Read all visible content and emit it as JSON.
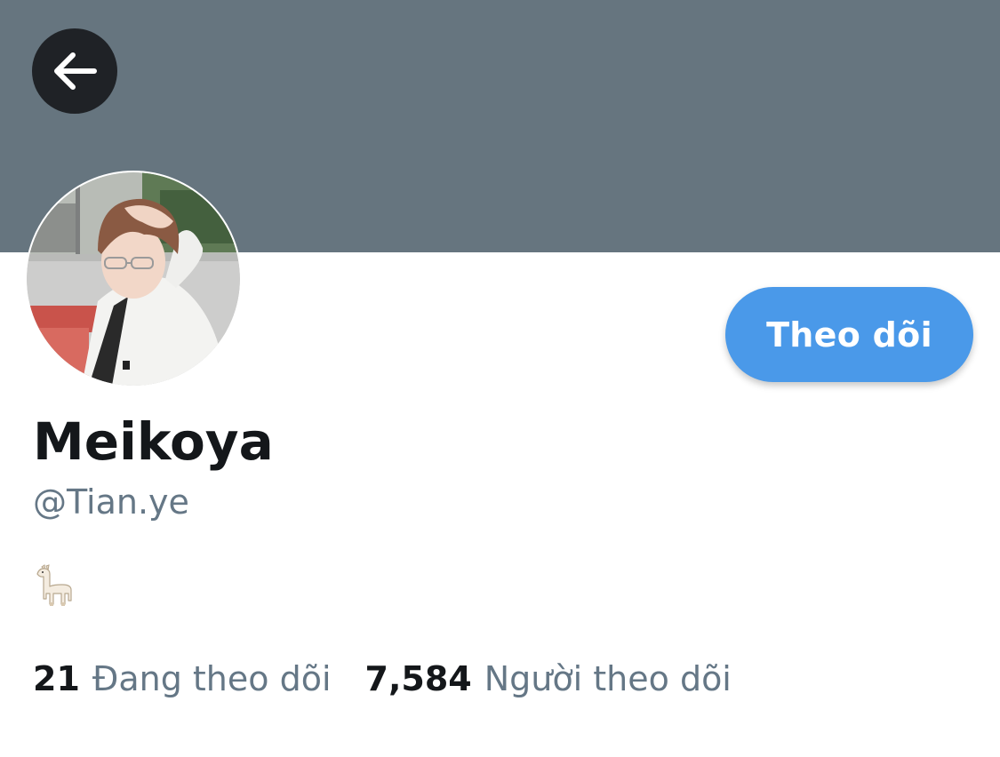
{
  "header": {
    "banner_color": "#66757f",
    "back_icon": "arrow-left-icon"
  },
  "profile": {
    "display_name": "Meikoya",
    "handle": "@Tian.ye",
    "bio_emoji": "llama",
    "follow_button_label": "Theo dõi",
    "follow_button_color": "#4a99e9"
  },
  "stats": {
    "following_count": "21",
    "following_label": "Đang theo dõi",
    "followers_count": "7,584",
    "followers_label": "Người theo dõi"
  }
}
